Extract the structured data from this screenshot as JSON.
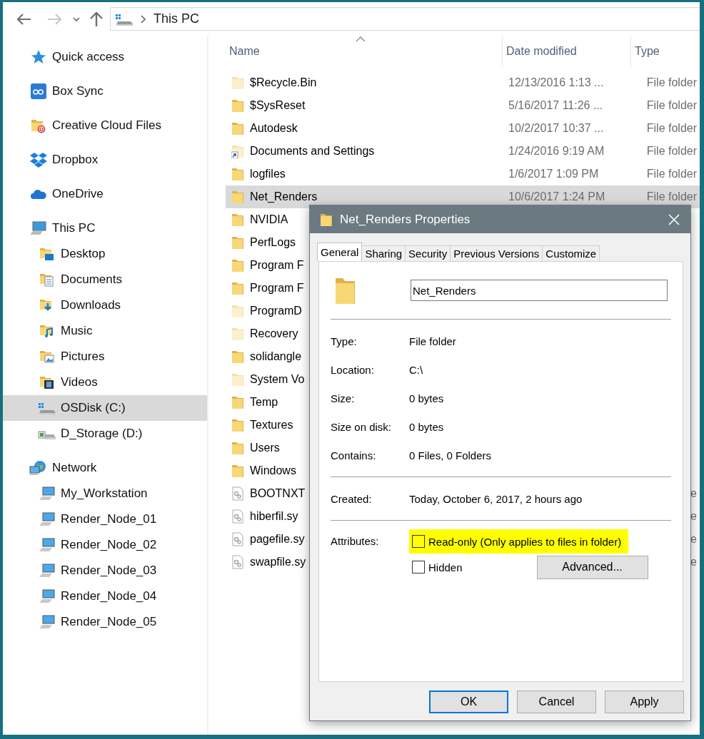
{
  "navigation": {
    "back": {
      "disabled": false
    },
    "forward": {
      "disabled": true
    }
  },
  "address_bar": {
    "path": [
      "This PC"
    ]
  },
  "sidebar": {
    "items": [
      {
        "label": "Quick access",
        "kind": "star",
        "selected": false
      },
      {
        "label": "Box Sync",
        "kind": "box",
        "selected": false
      },
      {
        "label": "Creative Cloud Files",
        "kind": "cloud-folder",
        "selected": false
      },
      {
        "label": "Dropbox",
        "kind": "dropbox",
        "selected": false
      },
      {
        "label": "OneDrive",
        "kind": "onedrive",
        "selected": false
      },
      {
        "label": "This PC",
        "kind": "pc",
        "selected": false,
        "children": [
          {
            "label": "Desktop",
            "kind": "desktop",
            "selected": false
          },
          {
            "label": "Documents",
            "kind": "documents",
            "selected": false
          },
          {
            "label": "Downloads",
            "kind": "downloads",
            "selected": false
          },
          {
            "label": "Music",
            "kind": "music",
            "selected": false
          },
          {
            "label": "Pictures",
            "kind": "pictures",
            "selected": false
          },
          {
            "label": "Videos",
            "kind": "videos",
            "selected": false
          },
          {
            "label": "OSDisk (C:)",
            "kind": "system-drive",
            "selected": true
          },
          {
            "label": "D_Storage (D:)",
            "kind": "drive",
            "selected": false
          }
        ]
      },
      {
        "label": "Network",
        "kind": "network",
        "selected": false,
        "children": [
          {
            "label": "My_Workstation",
            "kind": "computer",
            "selected": false
          },
          {
            "label": "Render_Node_01",
            "kind": "computer",
            "selected": false
          },
          {
            "label": "Render_Node_02",
            "kind": "computer",
            "selected": false
          },
          {
            "label": "Render_Node_03",
            "kind": "computer",
            "selected": false
          },
          {
            "label": "Render_Node_04",
            "kind": "computer",
            "selected": false
          },
          {
            "label": "Render_Node_05",
            "kind": "computer",
            "selected": false
          }
        ]
      }
    ]
  },
  "file_list": {
    "columns": [
      {
        "label": "Name",
        "sorted_ascending": true
      },
      {
        "label": "Date modified"
      },
      {
        "label": "Type"
      }
    ],
    "rows": [
      {
        "name": "$Recycle.Bin",
        "date": "12/13/2016 1:13 ...",
        "type": "File folder",
        "kind": "hidden-folder",
        "selected": false
      },
      {
        "name": "$SysReset",
        "date": "5/16/2017 11:26 ...",
        "type": "File folder",
        "kind": "folder",
        "selected": false
      },
      {
        "name": "Autodesk",
        "date": "10/2/2017 10:37 ...",
        "type": "File folder",
        "kind": "folder",
        "selected": false
      },
      {
        "name": "Documents and Settings",
        "date": "1/24/2016 9:19 AM",
        "type": "File folder",
        "kind": "shortcut",
        "selected": false
      },
      {
        "name": "logfiles",
        "date": "1/6/2017 1:09 PM",
        "type": "File folder",
        "kind": "folder",
        "selected": false
      },
      {
        "name": "Net_Renders",
        "date": "10/6/2017 1:24 PM",
        "type": "File folder",
        "kind": "folder",
        "selected": true
      },
      {
        "name": "NVIDIA",
        "kind": "folder",
        "selected": false
      },
      {
        "name": "PerfLogs",
        "kind": "folder",
        "selected": false
      },
      {
        "name": "Program F",
        "kind": "folder",
        "selected": false
      },
      {
        "name": "Program F",
        "kind": "folder",
        "selected": false
      },
      {
        "name": "ProgramD",
        "kind": "hidden-folder",
        "selected": false
      },
      {
        "name": "Recovery",
        "kind": "hidden-folder",
        "selected": false
      },
      {
        "name": "solidangle",
        "kind": "folder",
        "selected": false
      },
      {
        "name": "System Vo",
        "kind": "hidden-folder",
        "selected": false
      },
      {
        "name": "Temp",
        "kind": "folder",
        "selected": false
      },
      {
        "name": "Textures",
        "kind": "folder",
        "selected": false
      },
      {
        "name": "Users",
        "kind": "folder",
        "selected": false
      },
      {
        "name": "Windows",
        "kind": "folder",
        "selected": false
      },
      {
        "name": "BOOTNXT",
        "type": "e",
        "kind": "system-file",
        "selected": false
      },
      {
        "name": "hiberfil.sy",
        "type": "e",
        "kind": "system-file",
        "selected": false
      },
      {
        "name": "pagefile.sy",
        "type": "e",
        "kind": "system-file",
        "selected": false
      },
      {
        "name": "swapfile.sy",
        "type": "e",
        "kind": "system-file",
        "selected": false
      }
    ]
  },
  "dialog": {
    "title": "Net_Renders Properties",
    "tabs": [
      {
        "label": "General",
        "selected": true
      },
      {
        "label": "Sharing",
        "selected": false
      },
      {
        "label": "Security",
        "selected": false
      },
      {
        "label": "Previous Versions",
        "selected": false
      },
      {
        "label": "Customize",
        "selected": false
      }
    ],
    "name_field": {
      "value": "Net_Renders"
    },
    "property_groups": [
      [
        {
          "label": "Type:",
          "value": "File folder"
        },
        {
          "label": "Location:",
          "value": "C:\\"
        },
        {
          "label": "Size:",
          "value": "0 bytes"
        },
        {
          "label": "Size on disk:",
          "value": "0 bytes"
        },
        {
          "label": "Contains:",
          "value": "0 Files, 0 Folders"
        }
      ],
      [
        {
          "label": "Created:",
          "value": "Today, October 6, 2017, 2 hours ago"
        }
      ]
    ],
    "attributes": {
      "label": "Attributes:",
      "options": [
        {
          "label": "Read-only (Only applies to files in folder)",
          "checked": false,
          "highlighted": true
        },
        {
          "label": "Hidden",
          "checked": false,
          "highlighted": false
        }
      ],
      "advanced_button": "Advanced..."
    },
    "buttons": [
      {
        "label": "OK",
        "default": true
      },
      {
        "label": "Cancel",
        "default": false
      },
      {
        "label": "Apply",
        "default": false
      }
    ]
  }
}
